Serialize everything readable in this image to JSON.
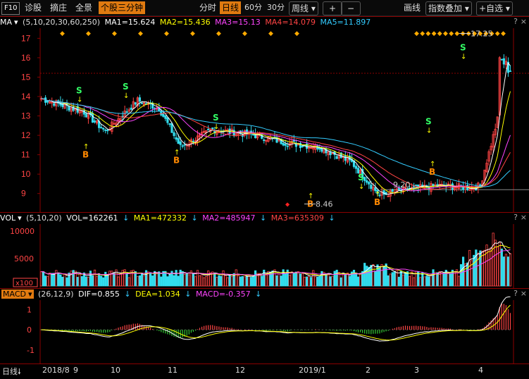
{
  "toolbar": {
    "f10": "F10",
    "tabs": [
      "诊股",
      "摘庄",
      "全景"
    ],
    "highlight": "个股三分钟",
    "periods": [
      "分时",
      "日线",
      "60分",
      "30分"
    ],
    "period_active": "日线",
    "week": "周线",
    "plus": "+",
    "minus": "−",
    "draw": "画线",
    "index_overlay": "指数叠加",
    "self_select": "+自选"
  },
  "price_panel": {
    "ma_label": "MA",
    "ma_params": "(5,10,20,30,60,250)",
    "ma1": "MA1=15.624",
    "ma2": "MA2=15.436",
    "ma3": "MA3=15.13",
    "ma4": "MA4=14.079",
    "ma5": "MA5=11.897",
    "y_ticks": [
      "17",
      "16",
      "15",
      "14",
      "13",
      "12",
      "11",
      "10",
      "9"
    ],
    "high_label": "17.25",
    "low_label": "8.46",
    "mark_label": "9.20",
    "b_label": "B",
    "s_label": "S",
    "arrow_up": "↑",
    "arrow_down": "↓",
    "colors": {
      "ma1": "#ffffff",
      "ma2": "#ffff00",
      "ma3": "#ff44ff",
      "ma4": "#ff4444",
      "ma5": "#33ccff"
    }
  },
  "vol_panel": {
    "label": "VOL",
    "params": "(5,10,20)",
    "vol": "VOL=162261",
    "ma1": "MA1=472332",
    "ma2": "MA2=485947",
    "ma3": "MA3=635309",
    "y_ticks": [
      "10000",
      "5000"
    ],
    "unit": "x100"
  },
  "macd_panel": {
    "label": "MACD",
    "params": "(26,12,9)",
    "dif": "DIF=0.855",
    "dea": "DEA=1.034",
    "macd": "MACD=-0.357",
    "y_ticks": [
      "1",
      "0",
      "-1"
    ]
  },
  "x_axis": {
    "period": "日线",
    "labels": [
      "2018/8",
      "9",
      "10",
      "11",
      "12",
      "2019/1",
      "2",
      "3",
      "4"
    ]
  },
  "help": "?",
  "close": "×"
}
